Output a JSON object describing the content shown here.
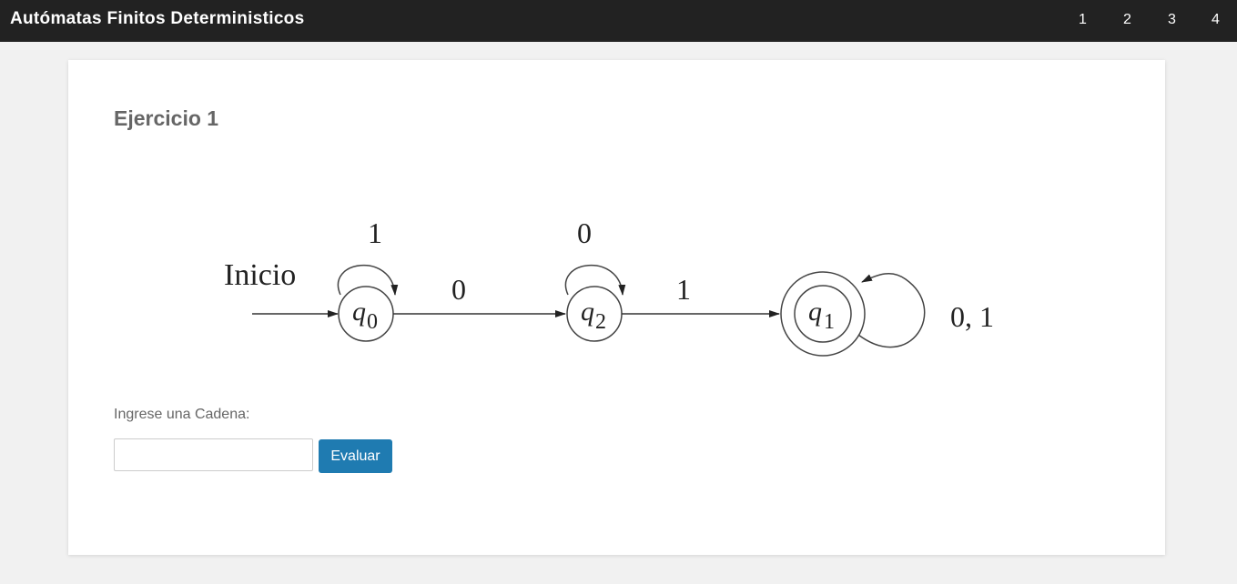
{
  "header": {
    "title": "Autómatas Finitos Deterministicos",
    "nav": [
      "1",
      "2",
      "3",
      "4"
    ]
  },
  "exercise": {
    "title": "Ejercicio 1"
  },
  "automaton": {
    "start_label": "Inicio",
    "states": [
      {
        "symbol": "q",
        "index": "0",
        "accepting": false
      },
      {
        "symbol": "q",
        "index": "2",
        "accepting": false
      },
      {
        "symbol": "q",
        "index": "1",
        "accepting": true
      }
    ],
    "transitions": [
      {
        "from": "q0",
        "to": "q0",
        "label": "1"
      },
      {
        "from": "q0",
        "to": "q2",
        "label": "0"
      },
      {
        "from": "q2",
        "to": "q2",
        "label": "0"
      },
      {
        "from": "q2",
        "to": "q1",
        "label": "1"
      },
      {
        "from": "q1",
        "to": "q1",
        "label": "0, 1"
      }
    ]
  },
  "form": {
    "label": "Ingrese una Cadena:",
    "input_value": "",
    "button_label": "Evaluar"
  },
  "colors": {
    "topbar": "#222222",
    "page_bg": "#f1f1f1",
    "button": "#1f7bb1",
    "title_text": "#666666"
  }
}
